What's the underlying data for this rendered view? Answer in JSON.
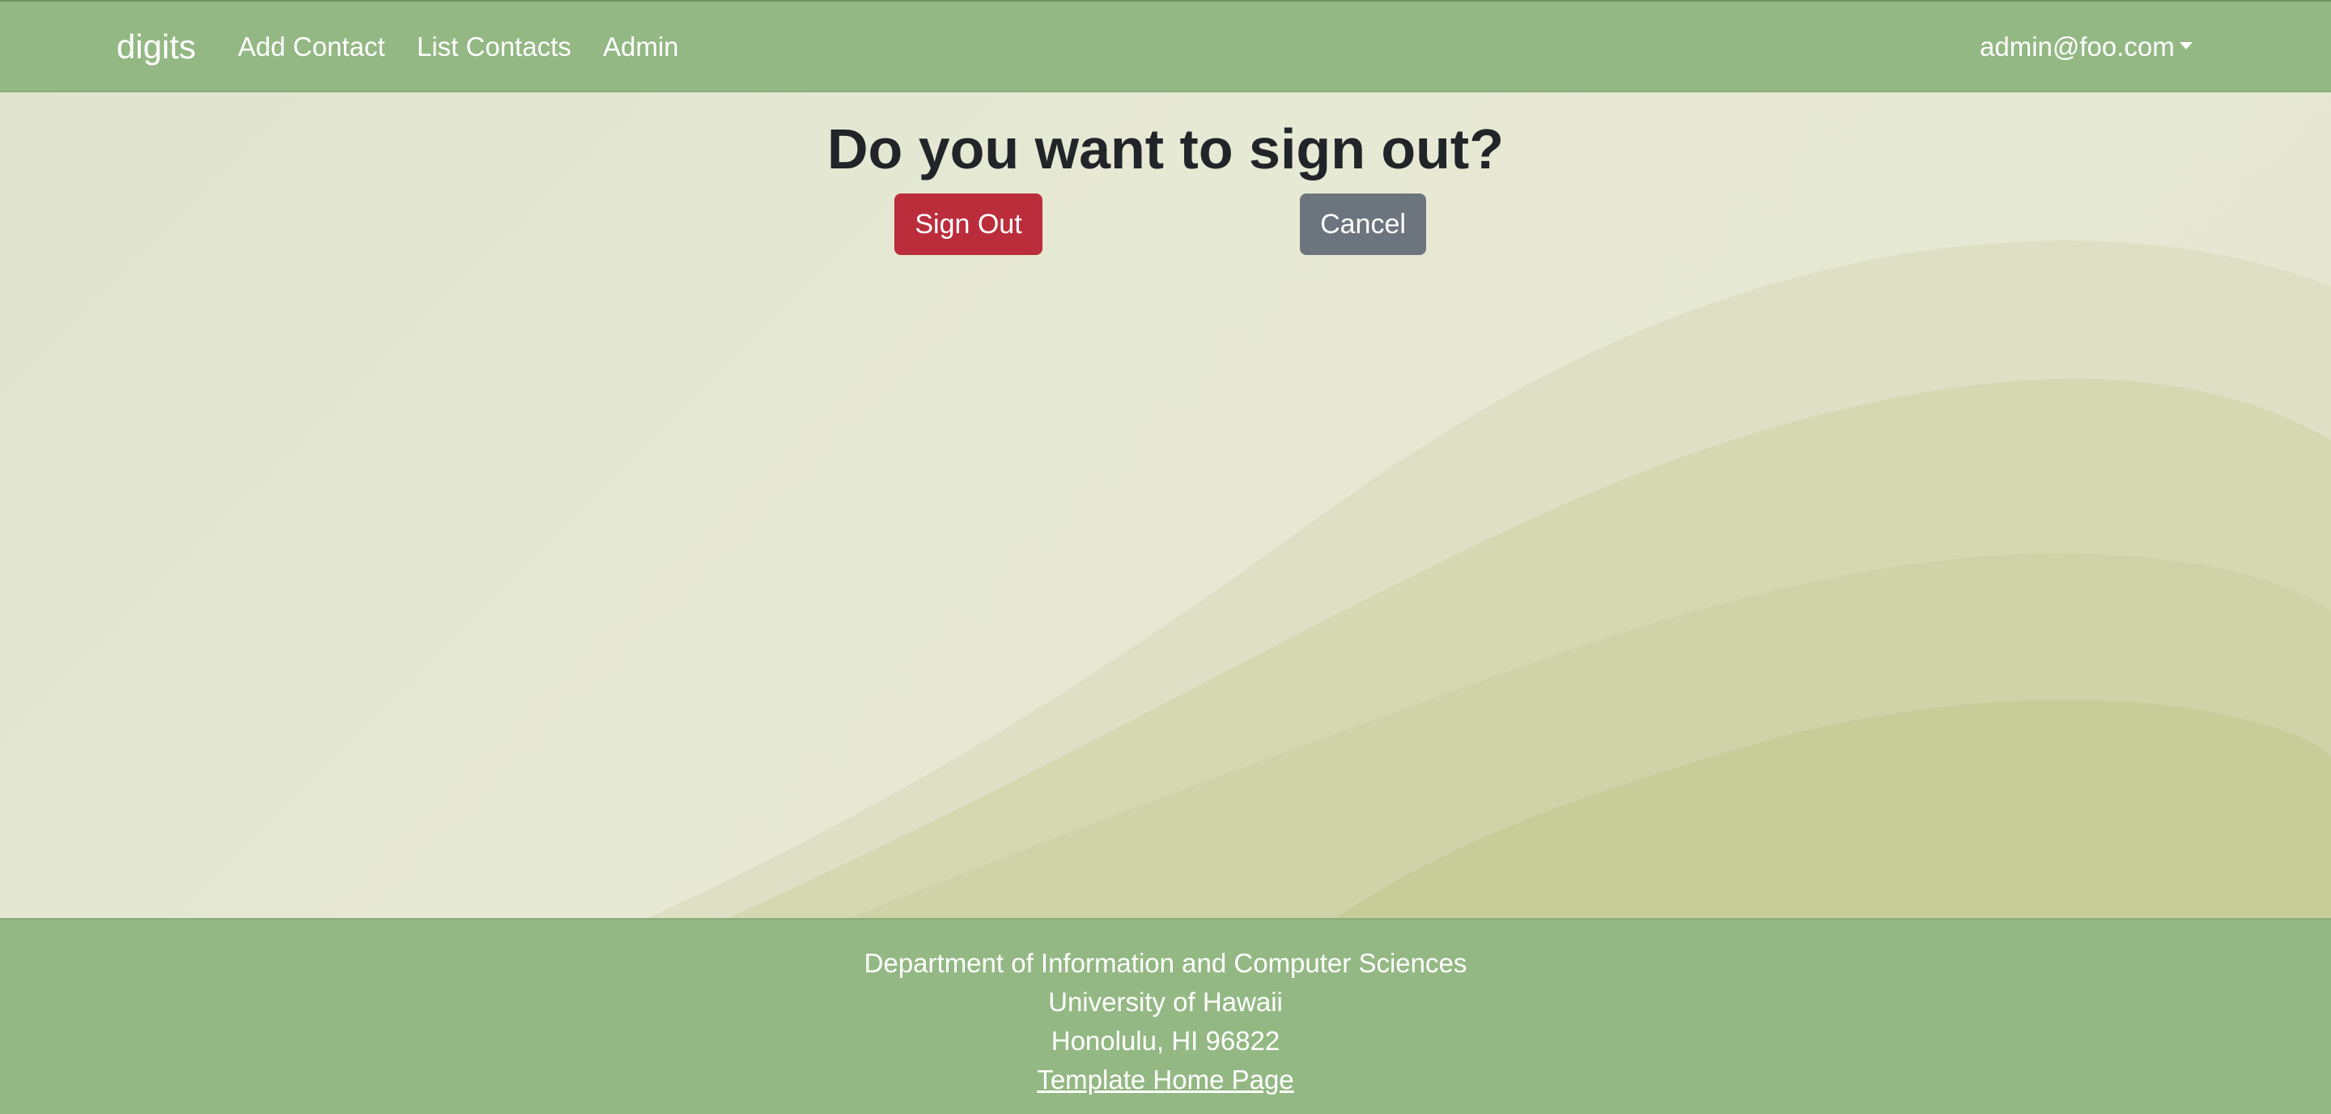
{
  "navbar": {
    "brand": "digits",
    "links": [
      "Add Contact",
      "List Contacts",
      "Admin"
    ],
    "user": "admin@foo.com"
  },
  "main": {
    "title": "Do you want to sign out?",
    "sign_out_label": "Sign Out",
    "cancel_label": "Cancel"
  },
  "footer": {
    "line1": "Department of Information and Computer Sciences",
    "line2": "University of Hawaii",
    "line3": "Honolulu, HI 96822",
    "link": "Template Home Page"
  },
  "colors": {
    "navbar": "#94b884",
    "danger": "#bb2d3b",
    "secondary": "#6c757d",
    "background": "#e3e6d2"
  }
}
